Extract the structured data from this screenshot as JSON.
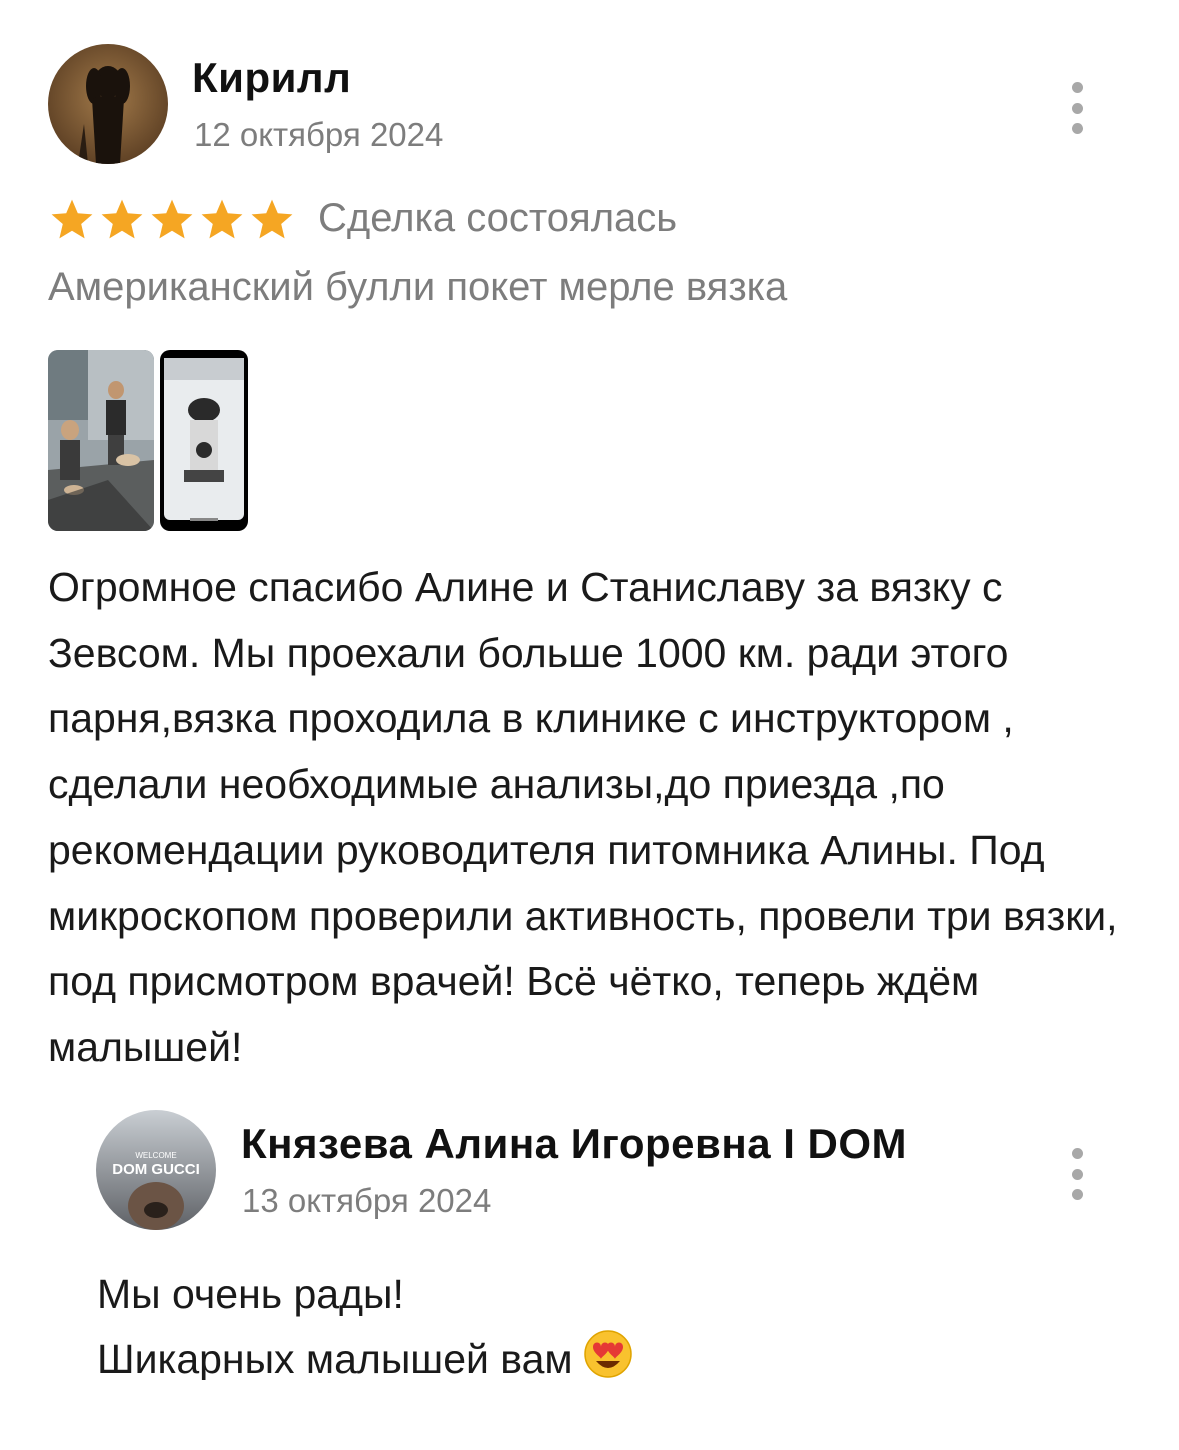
{
  "review": {
    "author": "Кирилл",
    "date": "12 октября 2024",
    "rating": 5,
    "rating_max": 5,
    "deal_status": "Сделка состоялась",
    "listing_title": "Американский булли покет мерле вязка",
    "text": "Огромное спасибо Алине и Станиславу за вязку с Зевсом. Мы проехали больше 1000 км. ради этого парня,вязка проходила в клинике с инструктором , сделали необходимые анализы,до приезда ,по рекомендации руководителя питомника Алины. Под микроскопом проверили активность, провели три вязки, под присмотром врачей! Всё чётко, теперь ждём малышей!",
    "star_color": "#f5a623"
  },
  "reply": {
    "author": "Князева Алина Игоревна I DOM",
    "date": "13 октября 2024",
    "avatar_text_top": "WELCOME",
    "avatar_text_main": "DOM GUCCI",
    "lines": [
      "Мы очень рады!",
      "Шикарных малышей вам"
    ]
  }
}
